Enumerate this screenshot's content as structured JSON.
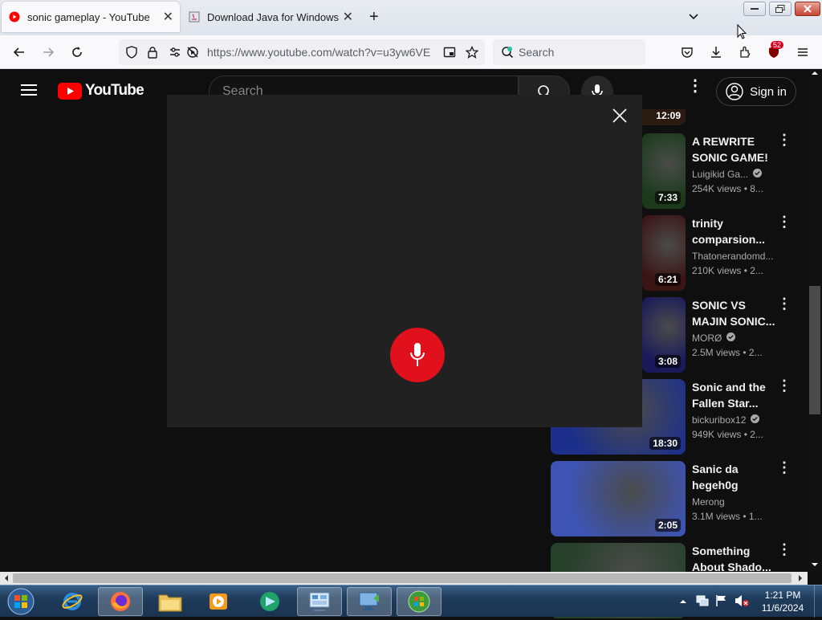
{
  "browser": {
    "tabs": [
      {
        "title": "sonic gameplay - YouTube",
        "active": true
      },
      {
        "title": "Download Java for Windows",
        "active": false
      }
    ],
    "new_tab_symbol": "+",
    "url": "https://www.youtube.com/watch?v=u3yw6VE",
    "search_placeholder": "Search",
    "extension_badge": "52"
  },
  "youtube": {
    "logo_text": "YouTube",
    "search_placeholder": "Search",
    "sign_in_label": "Sign in",
    "partial_top_duration": "12:09",
    "videos": [
      {
        "title": "A REWRITE SONIC GAME!",
        "channel": "Luigikid Ga...",
        "verified": true,
        "views": "254K views • 8...",
        "duration": "7:33",
        "thumb": "#1b3a1b"
      },
      {
        "title": "trinity comparsion...",
        "channel": "Thatonerandomd...",
        "verified": false,
        "views": "210K views • 2...",
        "duration": "6:21",
        "thumb": "#3b1414"
      },
      {
        "title": "SONIC VS MAJIN SONIC...",
        "channel": "MORØ",
        "verified": true,
        "views": "2.5M views • 2...",
        "duration": "3:08",
        "thumb": "#1a1a5a"
      },
      {
        "title": "Sonic and the Fallen Star...",
        "channel": "bickuribox12",
        "verified": true,
        "views": "949K views • 2...",
        "duration": "18:30",
        "thumb": "#1c2f8a"
      },
      {
        "title": "Sanic da hegeh0g",
        "channel": "Merong",
        "verified": false,
        "views": "3.1M views • 1...",
        "duration": "2:05",
        "thumb": "#3d54b5"
      },
      {
        "title": "Something About Shado...",
        "channel": "",
        "verified": false,
        "views": "",
        "duration": "",
        "thumb": "#26402a"
      }
    ]
  },
  "taskbar": {
    "time": "1:21 PM",
    "date": "11/6/2024"
  },
  "colors": {
    "yt_red": "#ff0000",
    "voice_mic_red": "#e1101d",
    "page_bg": "#0f0f0f",
    "dialog_bg": "#212121"
  }
}
